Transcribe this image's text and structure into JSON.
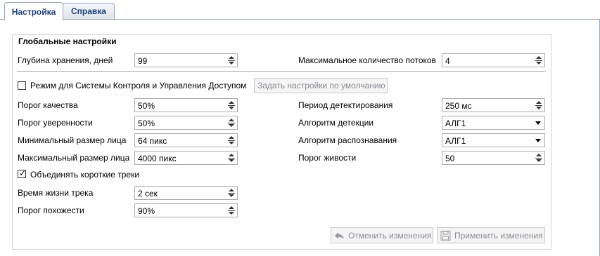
{
  "tabs": [
    {
      "label": "Настройка",
      "active": true
    },
    {
      "label": "Справка",
      "active": false
    }
  ],
  "group_title": "Глобальные настройки",
  "fields": {
    "storage_depth": {
      "label": "Глубина хранения, дней",
      "value": "99"
    },
    "max_threads": {
      "label": "Максимальное количество потоков",
      "value": "4"
    },
    "acs_mode": {
      "label": "Режим для Системы Контроля и Управления Доступом",
      "checked": false
    },
    "default_settings_button": "Задать настройки по умолчанию",
    "quality_threshold": {
      "label": "Порог качества",
      "value": "50%"
    },
    "confidence_threshold": {
      "label": "Порог уверенности",
      "value": "50%"
    },
    "min_face_size": {
      "label": "Минимальный размер лица",
      "value": "64 пикс"
    },
    "max_face_size": {
      "label": "Максимальный размер лица",
      "value": "4000 пикс"
    },
    "detection_period": {
      "label": "Период детектирования",
      "value": "250 мс"
    },
    "detection_algorithm": {
      "label": "Алгоритм детекции",
      "value": "АЛГ1"
    },
    "recognition_algorithm": {
      "label": "Алгоритм распознавания",
      "value": "АЛГ1"
    },
    "liveness_threshold": {
      "label": "Порог живости",
      "value": "50"
    },
    "merge_short_tracks": {
      "label": "Объединять короткие треки",
      "checked": true
    },
    "track_lifetime": {
      "label": "Время жизни трека",
      "value": "2 сек"
    },
    "similarity_threshold": {
      "label": "Порог похожести",
      "value": "90%"
    }
  },
  "actions": {
    "cancel_label": "Отменить изменения",
    "apply_label": "Применить изменения"
  },
  "icons": {
    "cancel": "undo-arrow-icon",
    "apply": "floppy-disk-icon",
    "checkbox_mark": "✓"
  }
}
